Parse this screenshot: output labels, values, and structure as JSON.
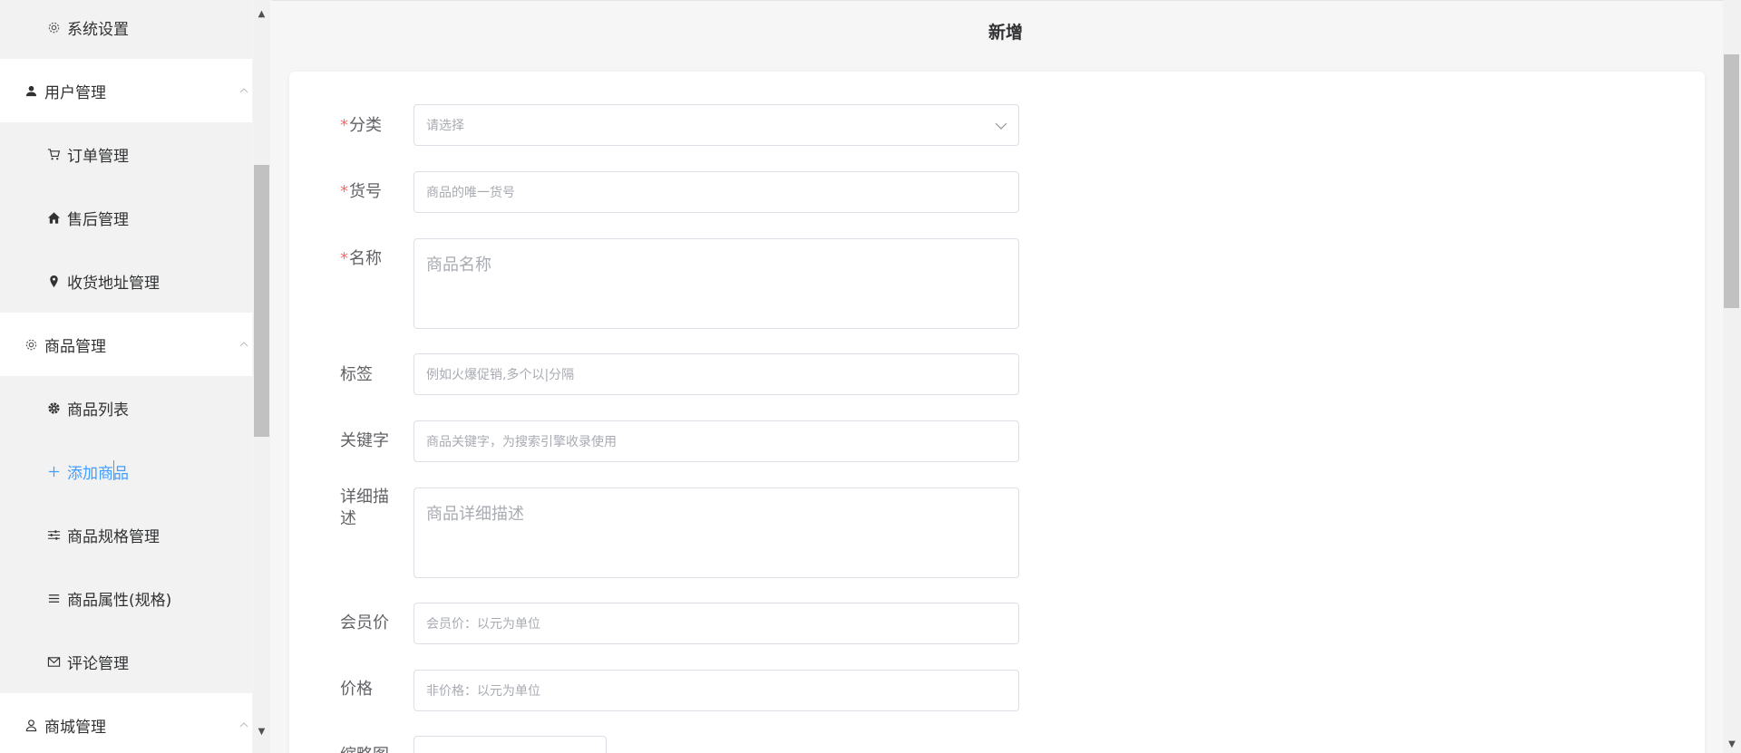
{
  "sidebar": {
    "items": [
      {
        "label": "系统设置",
        "icon": "gear-icon"
      },
      {
        "label": "用户管理",
        "icon": "user-icon"
      },
      {
        "label": "订单管理",
        "icon": "cart-icon"
      },
      {
        "label": "售后管理",
        "icon": "home-icon"
      },
      {
        "label": "收货地址管理",
        "icon": "location-icon"
      },
      {
        "label": "商品管理",
        "icon": "gear-icon"
      },
      {
        "label": "商品列表",
        "icon": "gear-filled-icon"
      },
      {
        "label": "添加商品",
        "icon": "plus-icon"
      },
      {
        "label": "商品规格管理",
        "icon": "sliders-icon"
      },
      {
        "label": "商品属性(规格)",
        "icon": "list-icon"
      },
      {
        "label": "评论管理",
        "icon": "message-icon"
      },
      {
        "label": "商城管理",
        "icon": "user-outline-icon"
      }
    ],
    "active_color": "#409eff"
  },
  "page": {
    "title": "新增"
  },
  "form": {
    "required_mark": "*",
    "category": {
      "label": "分类",
      "placeholder": "请选择"
    },
    "sku": {
      "label": "货号",
      "placeholder": "商品的唯一货号"
    },
    "name": {
      "label": "名称",
      "placeholder": "商品名称"
    },
    "tags": {
      "label": "标签",
      "placeholder": "例如火爆促销,多个以|分隔"
    },
    "keywords": {
      "label": "关键字",
      "placeholder": "商品关键字，为搜索引擎收录使用"
    },
    "description": {
      "label": "详细描述",
      "placeholder": "商品详细描述"
    },
    "member_price": {
      "label": "会员价",
      "placeholder": "会员价：以元为单位"
    },
    "price": {
      "label": "价格",
      "placeholder": "非价格：以元为单位"
    },
    "thumbnail": {
      "label": "缩略图"
    }
  }
}
